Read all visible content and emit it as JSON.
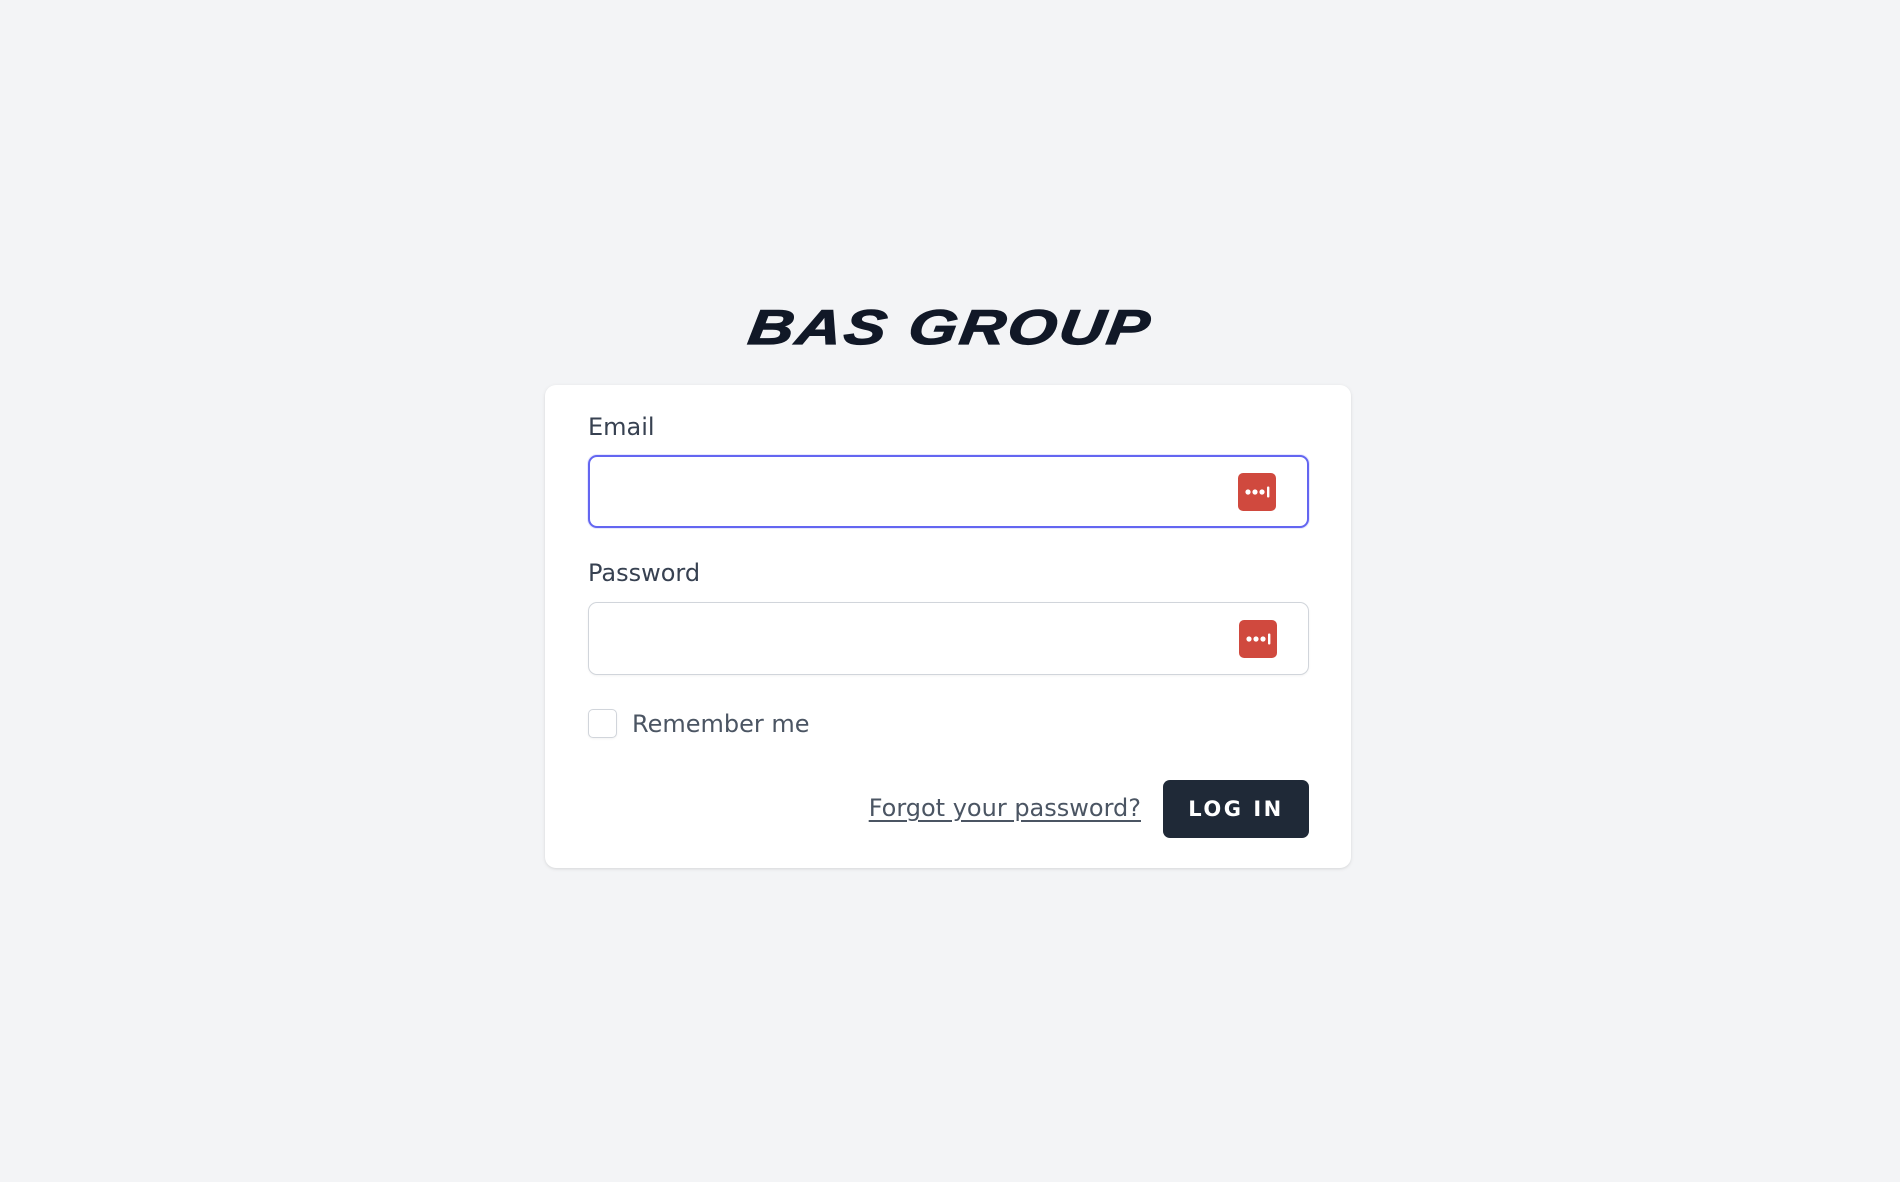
{
  "brand": {
    "logo_text": "BAS GROUP"
  },
  "form": {
    "email": {
      "label": "Email",
      "value": "",
      "placeholder": ""
    },
    "password": {
      "label": "Password",
      "value": "",
      "placeholder": ""
    },
    "remember_label": "Remember me",
    "remember_checked": false,
    "forgot_link": "Forgot your password?",
    "submit_label": "LOG IN"
  },
  "icons": {
    "field_addon": "password-manager-icon"
  },
  "colors": {
    "background": "#f3f4f6",
    "card": "#ffffff",
    "focus_ring": "#6366f1",
    "button": "#1f2937",
    "password_manager_icon": "#d0493e",
    "logo": "#111827"
  }
}
